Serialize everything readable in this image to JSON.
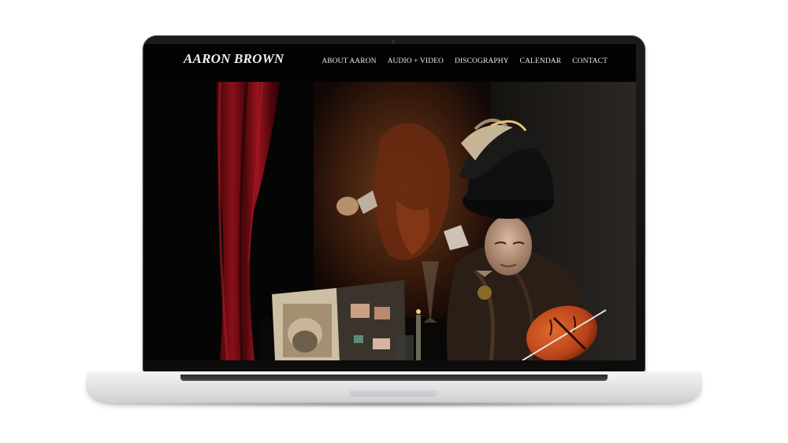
{
  "site": {
    "title": "AARON BROWN",
    "nav": [
      {
        "label": "ABOUT AARON"
      },
      {
        "label": "AUDIO + VIDEO"
      },
      {
        "label": "DISCOGRAPHY"
      },
      {
        "label": "CALENDAR"
      },
      {
        "label": "CONTACT"
      }
    ]
  },
  "colors": {
    "background": "#000000",
    "nav_text": "#e9e9e9",
    "curtain": "#7a0c14",
    "violin": "#b8421a"
  },
  "device": "laptop-mockup"
}
